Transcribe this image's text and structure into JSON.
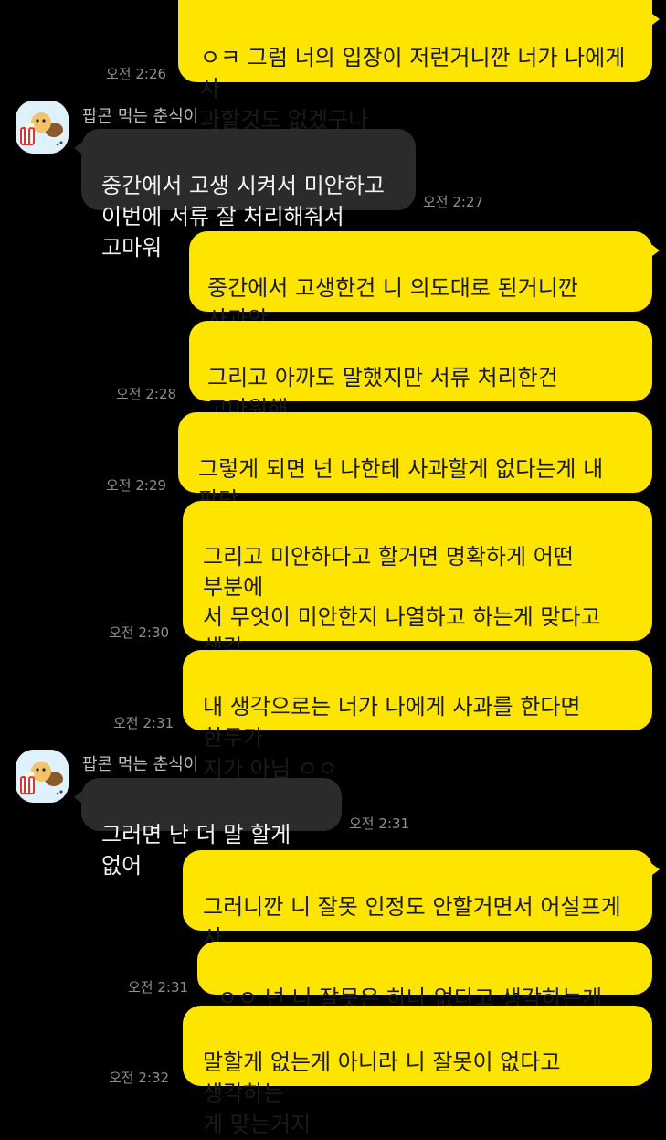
{
  "sender_name": "팝콘 먹는 춘식이",
  "messages": [
    {
      "id": "m1",
      "text": "ㅇㅋ 그럼 너의 입장이 저런거니깐 너가 나에게 사\n과할것도 없겠구나",
      "time": "오전 2:26"
    },
    {
      "id": "m2",
      "text": "중간에서 고생 시켜서 미안하고\n이번에 서류 잘 처리해줘서 고마워",
      "time": "오전 2:27"
    },
    {
      "id": "m3",
      "text": "중간에서 고생한건 니 의도대로 된거니깐 사과안\n해도 되는거 아님?",
      "time": ""
    },
    {
      "id": "m4",
      "text": "그리고 아까도 말했지만 서류 처리한건 고마워해\n야할게 아니라 미안해야하는거고",
      "time": "오전 2:28"
    },
    {
      "id": "m5",
      "text": "그렇게 되면 넌 나한테 사과할게 없다는게 내 판단\n인데",
      "time": "오전 2:29"
    },
    {
      "id": "m6",
      "text": "그리고 미안하다고 할거면 명확하게 어떤 부분에\n서 무엇이 미안한지 나열하고 하는게 맞다고 생각\n하는데? 그렇게 두루뭉실하게 \"고생시켜서 미\n안\"이 아니라?",
      "time": "오전 2:30"
    },
    {
      "id": "m7",
      "text": "내 생각으로는 너가 나에게 사과를 한다면 한두가\n지가 아님 ㅇㅇ",
      "time": "오전 2:31"
    },
    {
      "id": "m8",
      "text": "그러면 난 더 말 할게 없어",
      "time": "오전 2:31"
    },
    {
      "id": "m9",
      "text": "그러니깐 니 잘못 인정도 안할거면서 어설프게 사\n과할 생각하지마셈",
      "time": ""
    },
    {
      "id": "m10",
      "text": "ㅇㅇ 넌 니 잘못은 하나 없다고 생각하는게 맞음",
      "time": "오전 2:31"
    },
    {
      "id": "m11",
      "text": "말할게 없는게 아니라 니 잘못이 없다고 생각하는\n게 맞는거지",
      "time": "오전 2:32"
    }
  ]
}
